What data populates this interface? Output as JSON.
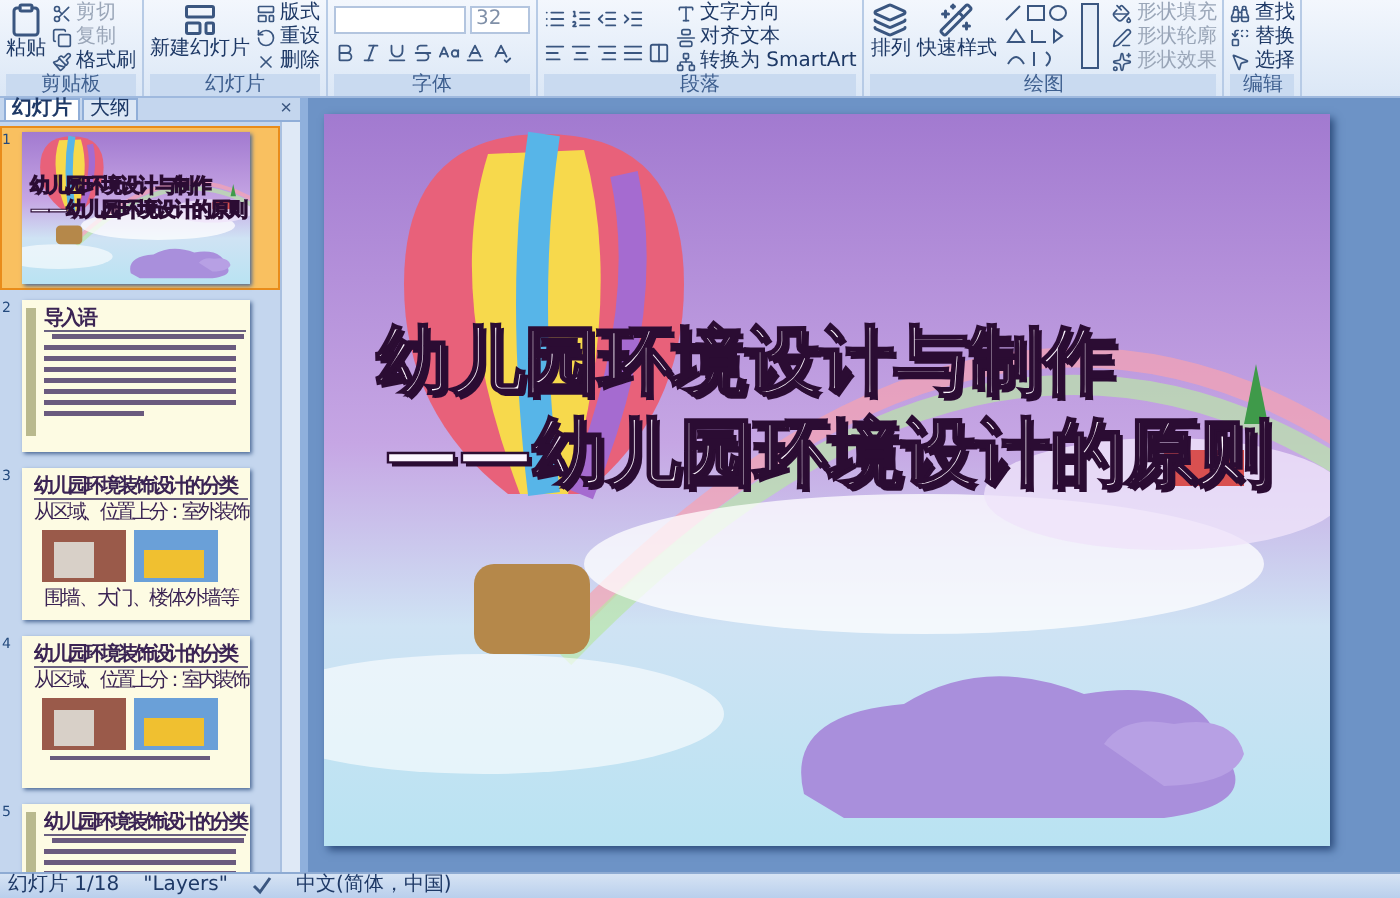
{
  "ribbon": [
    {
      "label": "剪贴板",
      "large": [
        "粘贴"
      ],
      "small": [
        {
          "label": "剪切",
          "disabled": true
        },
        {
          "label": "复制",
          "disabled": true
        },
        {
          "label": "格式刷",
          "disabled": false
        }
      ]
    },
    {
      "label": "幻灯片",
      "large": [
        "新建幻灯片"
      ],
      "small": [
        {
          "label": "版式",
          "disabled": false
        },
        {
          "label": "重设",
          "disabled": false
        },
        {
          "label": "删除",
          "disabled": false
        }
      ]
    },
    {
      "label": "字体",
      "font_size": "32"
    },
    {
      "label": "段落",
      "small": [
        {
          "label": "文字方向",
          "disabled": false
        },
        {
          "label": "对齐文本",
          "disabled": false
        },
        {
          "label": "转换为 SmartArt",
          "disabled": false
        }
      ]
    },
    {
      "label": "绘图",
      "shapes": true,
      "large": [
        "排列",
        "快速样式"
      ],
      "small": [
        {
          "label": "形状填充",
          "disabled": true
        },
        {
          "label": "形状轮廓",
          "disabled": true
        },
        {
          "label": "形状效果",
          "disabled": true
        }
      ]
    },
    {
      "label": "编辑",
      "small": [
        {
          "label": "查找",
          "disabled": false
        },
        {
          "label": "替换",
          "disabled": false
        },
        {
          "label": "选择",
          "disabled": false
        }
      ]
    }
  ],
  "panel": {
    "tabs": [
      {
        "label": "幻灯片",
        "selected": true
      },
      {
        "label": "大纲",
        "selected": false
      }
    ],
    "close": "×"
  },
  "thumbnails": [
    {
      "number": "1",
      "selected": true,
      "kind": "title",
      "lines": [
        "幼儿园环境设计与制作",
        "——幼儿园环境设计的原则"
      ]
    },
    {
      "number": "2",
      "selected": false,
      "kind": "text",
      "title": "导入语"
    },
    {
      "number": "3",
      "selected": false,
      "kind": "photos",
      "title": "幼儿园环境装饰设计的分类",
      "subtitle": "从区域、位置上分：室外装饰",
      "caption": "围墙、大门、楼体外墙等"
    },
    {
      "number": "4",
      "selected": false,
      "kind": "photos",
      "title": "幼儿园环境装饰设计的分类",
      "subtitle": "从区域、位置上分：室内装饰"
    },
    {
      "number": "5",
      "selected": false,
      "kind": "text",
      "title": "幼儿园环境装饰设计的分类"
    }
  ],
  "slide": {
    "title_lines": [
      "幼儿园环境设计与制作",
      "——幼儿园环境设计的原则"
    ]
  },
  "status_bar": {
    "slide": "幻灯片 1/18",
    "theme": "\"Layers\"",
    "language": "中文(简体，中国)"
  }
}
